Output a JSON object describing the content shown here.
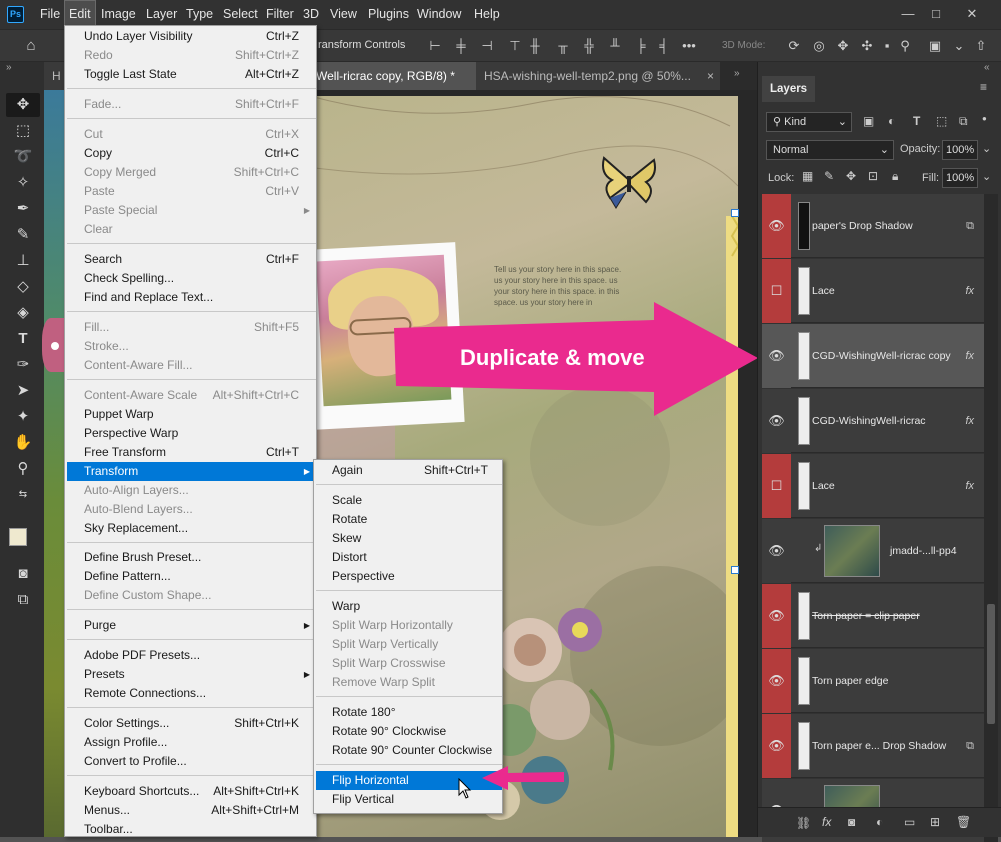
{
  "app": {
    "logo": "Ps"
  },
  "menubar": {
    "items": [
      "File",
      "Edit",
      "Image",
      "Layer",
      "Type",
      "Select",
      "Filter",
      "3D",
      "View",
      "Plugins",
      "Window",
      "Help"
    ],
    "active": "Edit",
    "window_controls": {
      "minimize": "—",
      "maximize": "□",
      "close": "✕"
    }
  },
  "options_bar": {
    "transform_controls_label": "ransform Controls",
    "mode_3d_label": "3D Mode:",
    "more_label": "•••"
  },
  "tabs": [
    {
      "label": "H",
      "active": false
    },
    {
      "label": "Well-ricrac copy, RGB/8) *",
      "close": "×",
      "active": true
    },
    {
      "label": "HSA-wishing-well-temp2.png @ 50%...",
      "close": "×",
      "active": false
    }
  ],
  "collapse_arrows": "»",
  "canvas": {
    "story_text": "Tell us your story here in this space. us your story here in this space. us your story here in this space. in this space. us your story here in",
    "callout_text": "Duplicate & move"
  },
  "edit_menu": [
    {
      "label": "Undo Layer Visibility",
      "shortcut": "Ctrl+Z",
      "disabled": false
    },
    {
      "label": "Redo",
      "shortcut": "Shift+Ctrl+Z",
      "disabled": true
    },
    {
      "label": "Toggle Last State",
      "shortcut": "Alt+Ctrl+Z",
      "disabled": false
    },
    {
      "sep": true
    },
    {
      "label": "Fade...",
      "shortcut": "Shift+Ctrl+F",
      "disabled": true
    },
    {
      "sep": true
    },
    {
      "label": "Cut",
      "shortcut": "Ctrl+X",
      "disabled": true
    },
    {
      "label": "Copy",
      "shortcut": "Ctrl+C",
      "disabled": false
    },
    {
      "label": "Copy Merged",
      "shortcut": "Shift+Ctrl+C",
      "disabled": true
    },
    {
      "label": "Paste",
      "shortcut": "Ctrl+V",
      "disabled": true
    },
    {
      "label": "Paste Special",
      "shortcut": "",
      "submenu": true,
      "disabled": true
    },
    {
      "label": "Clear",
      "shortcut": "",
      "disabled": true
    },
    {
      "sep": true
    },
    {
      "label": "Search",
      "shortcut": "Ctrl+F",
      "disabled": false
    },
    {
      "label": "Check Spelling...",
      "shortcut": "",
      "disabled": false
    },
    {
      "label": "Find and Replace Text...",
      "shortcut": "",
      "disabled": false
    },
    {
      "sep": true
    },
    {
      "label": "Fill...",
      "shortcut": "Shift+F5",
      "disabled": true
    },
    {
      "label": "Stroke...",
      "shortcut": "",
      "disabled": true
    },
    {
      "label": "Content-Aware Fill...",
      "shortcut": "",
      "disabled": true
    },
    {
      "sep": true
    },
    {
      "label": "Content-Aware Scale",
      "shortcut": "Alt+Shift+Ctrl+C",
      "disabled": true
    },
    {
      "label": "Puppet Warp",
      "shortcut": "",
      "disabled": false
    },
    {
      "label": "Perspective Warp",
      "shortcut": "",
      "disabled": false
    },
    {
      "label": "Free Transform",
      "shortcut": "Ctrl+T",
      "disabled": false
    },
    {
      "label": "Transform",
      "shortcut": "",
      "submenu": true,
      "highlight": true,
      "disabled": false
    },
    {
      "label": "Auto-Align Layers...",
      "shortcut": "",
      "disabled": true
    },
    {
      "label": "Auto-Blend Layers...",
      "shortcut": "",
      "disabled": true
    },
    {
      "label": "Sky Replacement...",
      "shortcut": "",
      "disabled": false
    },
    {
      "sep": true
    },
    {
      "label": "Define Brush Preset...",
      "shortcut": "",
      "disabled": false
    },
    {
      "label": "Define Pattern...",
      "shortcut": "",
      "disabled": false
    },
    {
      "label": "Define Custom Shape...",
      "shortcut": "",
      "disabled": true
    },
    {
      "sep": true
    },
    {
      "label": "Purge",
      "shortcut": "",
      "submenu": true,
      "disabled": false
    },
    {
      "sep": true
    },
    {
      "label": "Adobe PDF Presets...",
      "shortcut": "",
      "disabled": false
    },
    {
      "label": "Presets",
      "shortcut": "",
      "submenu": true,
      "disabled": false
    },
    {
      "label": "Remote Connections...",
      "shortcut": "",
      "disabled": false
    },
    {
      "sep": true
    },
    {
      "label": "Color Settings...",
      "shortcut": "Shift+Ctrl+K",
      "disabled": false
    },
    {
      "label": "Assign Profile...",
      "shortcut": "",
      "disabled": false
    },
    {
      "label": "Convert to Profile...",
      "shortcut": "",
      "disabled": false
    },
    {
      "sep": true
    },
    {
      "label": "Keyboard Shortcuts...",
      "shortcut": "Alt+Shift+Ctrl+K",
      "disabled": false
    },
    {
      "label": "Menus...",
      "shortcut": "Alt+Shift+Ctrl+M",
      "disabled": false
    },
    {
      "label": "Toolbar...",
      "shortcut": "",
      "disabled": false
    }
  ],
  "transform_submenu": [
    {
      "label": "Again",
      "shortcut": "Shift+Ctrl+T",
      "disabled": false
    },
    {
      "sep": true
    },
    {
      "label": "Scale",
      "disabled": false
    },
    {
      "label": "Rotate",
      "disabled": false
    },
    {
      "label": "Skew",
      "disabled": false
    },
    {
      "label": "Distort",
      "disabled": false
    },
    {
      "label": "Perspective",
      "disabled": false
    },
    {
      "sep": true
    },
    {
      "label": "Warp",
      "disabled": false
    },
    {
      "label": "Split Warp Horizontally",
      "disabled": true
    },
    {
      "label": "Split Warp Vertically",
      "disabled": true
    },
    {
      "label": "Split Warp Crosswise",
      "disabled": true
    },
    {
      "label": "Remove Warp Split",
      "disabled": true
    },
    {
      "sep": true
    },
    {
      "label": "Rotate 180°",
      "disabled": false
    },
    {
      "label": "Rotate 90° Clockwise",
      "disabled": false
    },
    {
      "label": "Rotate 90° Counter Clockwise",
      "disabled": false
    },
    {
      "sep": true
    },
    {
      "label": "Flip Horizontal",
      "disabled": false,
      "highlight": true
    },
    {
      "label": "Flip Vertical",
      "disabled": false
    }
  ],
  "layers_panel": {
    "title": "Layers",
    "menu_icon": "≡",
    "filter_kind": "Kind",
    "blend_mode": "Normal",
    "opacity_label": "Opacity:",
    "opacity_value": "100%",
    "lock_label": "Lock:",
    "fill_label": "Fill:",
    "fill_value": "100%",
    "layers": [
      {
        "name": "paper's Drop Shadow",
        "visible": true,
        "red": true,
        "thumb": "dark",
        "fx": false,
        "smart": true
      },
      {
        "name": "Lace",
        "visible": false,
        "red": true,
        "thumb": "light",
        "fx": true
      },
      {
        "name": "CGD-WishingWell-ricrac copy",
        "visible": true,
        "red": false,
        "selected": true,
        "thumb": "light",
        "fx": true
      },
      {
        "name": "CGD-WishingWell-ricrac",
        "visible": true,
        "red": false,
        "thumb": "light",
        "fx": true
      },
      {
        "name": "Lace",
        "visible": false,
        "red": true,
        "thumb": "light",
        "fx": true
      },
      {
        "name": "jmadd-...ll-pp4",
        "visible": true,
        "red": false,
        "thumb": "big",
        "fx": false,
        "clipped": true
      },
      {
        "name": "Torn paper = clip paper",
        "visible": true,
        "red": true,
        "thumb": "light",
        "fx": false,
        "strike": true
      },
      {
        "name": "Torn paper edge",
        "visible": true,
        "red": true,
        "thumb": "light",
        "fx": false
      },
      {
        "name": "Torn paper e... Drop Shadow",
        "visible": true,
        "red": true,
        "thumb": "light",
        "fx": false,
        "smart": true
      },
      {
        "name": "",
        "visible": true,
        "red": false,
        "thumb": "big",
        "fx": false
      }
    ],
    "fx_label": "fx"
  },
  "colors": {
    "accent": "#0078d7",
    "callout": "#ea2a8e",
    "layer_red": "#b43c3c"
  }
}
